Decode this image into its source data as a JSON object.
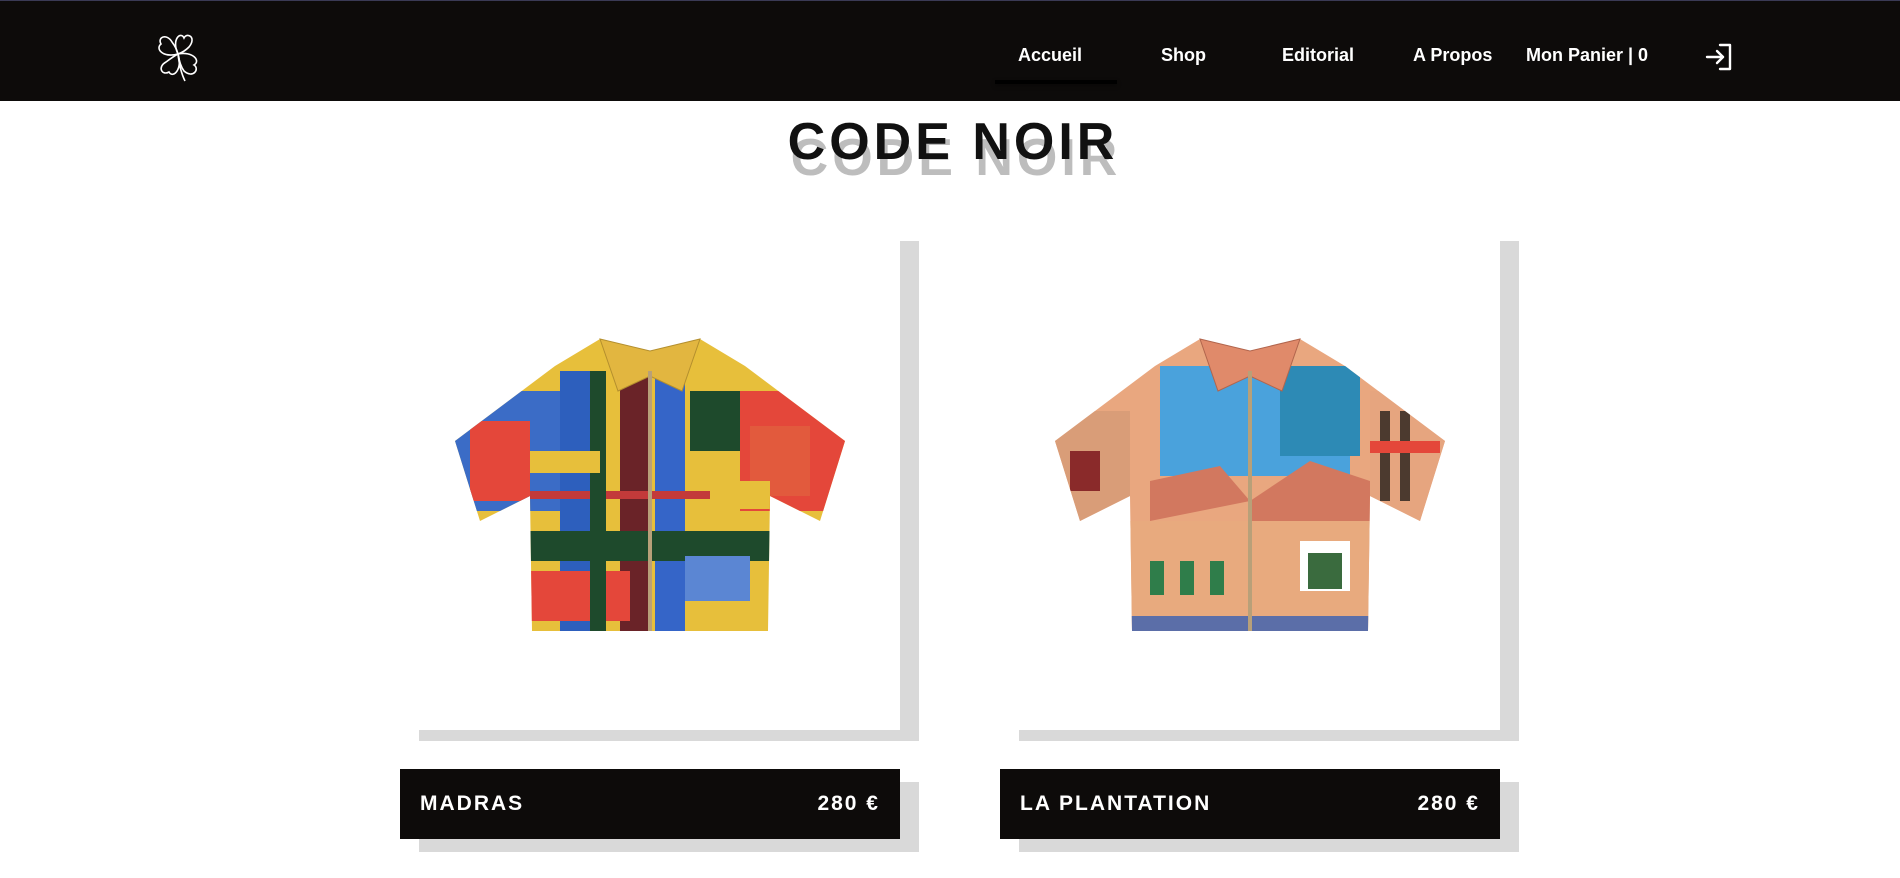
{
  "header": {
    "nav": [
      {
        "label": "Accueil"
      },
      {
        "label": "Shop"
      },
      {
        "label": "Editorial"
      },
      {
        "label": "A Propos"
      },
      {
        "label": "Mon Panier | 0"
      }
    ],
    "logo_icon": "clover-logo-icon",
    "login_icon": "sign-in-icon"
  },
  "title": "CODE NOIR",
  "products": [
    {
      "name": "MADRAS",
      "price": "280 €",
      "image": "madras-shirt"
    },
    {
      "name": "LA PLANTATION",
      "price": "280 €",
      "image": "plantation-shirt"
    }
  ],
  "colors": {
    "header_bg": "#0d0b0a",
    "label_bg": "#0d0b0a",
    "shadow": "#d9d9d9"
  }
}
